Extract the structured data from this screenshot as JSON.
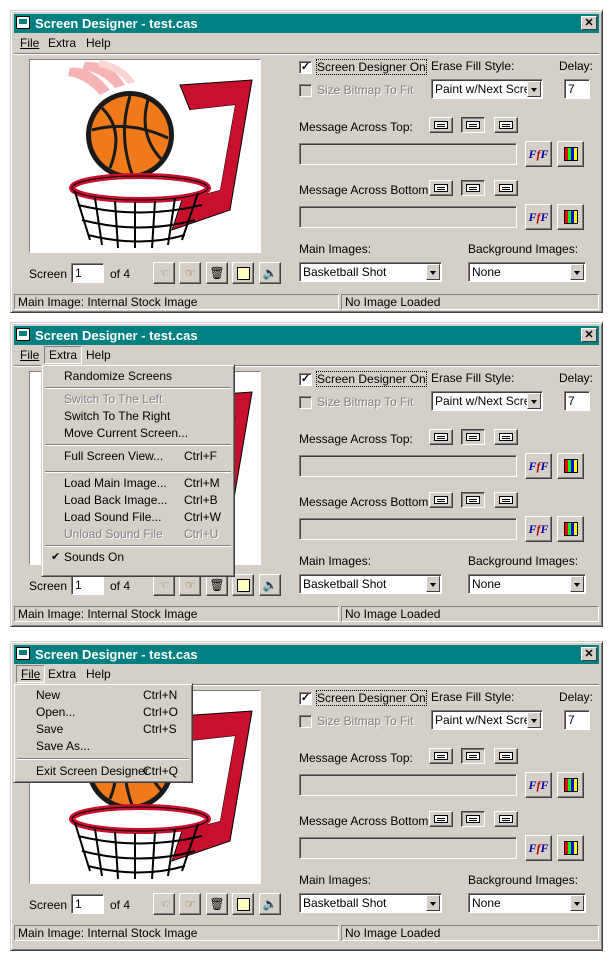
{
  "app": {
    "title": "Screen Designer - test.cas",
    "title_short": "Screen Designer - test.cas",
    "close_glyph": "✕"
  },
  "menubar": {
    "file": "File",
    "extra": "Extra",
    "help": "Help"
  },
  "controls": {
    "screen_designer_on": {
      "label": "Screen Designer On",
      "checked": true
    },
    "size_bitmap": {
      "label": "Size Bitmap To Fit",
      "checked": false,
      "disabled": true
    },
    "erase_fill_style_label": "Erase Fill Style:",
    "erase_fill_style_value": "Paint w/Next Scree",
    "delay_label": "Delay:",
    "delay_value": "7",
    "message_top_label": "Message Across Top:",
    "message_top_value": "",
    "message_bottom_label": "Message Across Bottom:",
    "message_bottom_value": "",
    "main_images_label": "Main Images:",
    "main_images_value": "Basketball Shot",
    "background_images_label": "Background Images:",
    "background_images_value": "None",
    "screen_label": "Screen",
    "screen_value": "1",
    "of_label": "of 4",
    "nav_icons": [
      "hand-left-icon",
      "hand-right-icon",
      "trash-icon",
      "square-icon",
      "speaker-icon"
    ]
  },
  "status": {
    "left": "Main Image: Internal Stock Image",
    "right": "No Image Loaded"
  },
  "extra_menu": {
    "items": [
      {
        "label": "Randomize Screens",
        "shortcut": "",
        "disabled": false
      },
      {
        "label": "Switch To The Left",
        "shortcut": "",
        "disabled": true
      },
      {
        "label": "Switch To The Right",
        "shortcut": "",
        "disabled": false
      },
      {
        "label": "Move Current Screen...",
        "shortcut": "",
        "disabled": false
      },
      {
        "label": "Full Screen View...",
        "shortcut": "Ctrl+F",
        "disabled": false
      },
      {
        "label": "Load Main Image...",
        "shortcut": "Ctrl+M",
        "disabled": false
      },
      {
        "label": "Load Back Image...",
        "shortcut": "Ctrl+B",
        "disabled": false
      },
      {
        "label": "Load Sound File...",
        "shortcut": "Ctrl+W",
        "disabled": false
      },
      {
        "label": "Unload Sound File",
        "shortcut": "Ctrl+U",
        "disabled": true
      },
      {
        "label": "Sounds On",
        "shortcut": "",
        "disabled": false,
        "checked": true
      }
    ]
  },
  "file_menu": {
    "items": [
      {
        "label": "New",
        "shortcut": "Ctrl+N"
      },
      {
        "label": "Open...",
        "shortcut": "Ctrl+O"
      },
      {
        "label": "Save",
        "shortcut": "Ctrl+S"
      },
      {
        "label": "Save As...",
        "shortcut": ""
      },
      {
        "label": "Exit Screen Designer",
        "shortcut": "Ctrl+Q"
      }
    ]
  },
  "colors": {
    "titlebar": "#008080",
    "face": "#d4d0c8",
    "ball": "#f07a1a",
    "rim": "#c8102e"
  }
}
